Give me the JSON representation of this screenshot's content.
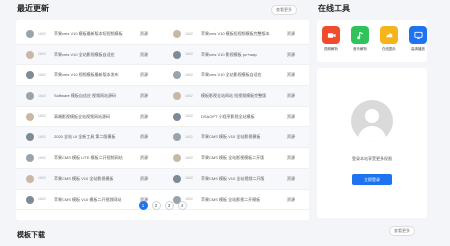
{
  "sections": {
    "latest": "最近更新",
    "tools": "在线工具",
    "templates": "模板下载"
  },
  "latest_more": "查看更多",
  "templates_more": "查看更多",
  "rows": [
    {
      "left": {
        "sub": "1602",
        "title": "苹果cms V10 模板最新版本短视频模板",
        "tag": "资源"
      },
      "right": {
        "sub": "1602",
        "title": "苹果cms V10 模板短视频模板完整版本",
        "tag": "资源"
      }
    },
    {
      "left": {
        "sub": "1602",
        "title": "苹果cms V10 全站影视模板自适应",
        "tag": "资源"
      },
      "right": {
        "sub": "1602",
        "title": "苹果cms V10 影视模板 pc+wap",
        "tag": "资源"
      }
    },
    {
      "left": {
        "sub": "1602",
        "title": "苹果cms V10 视频模板最新版本发布",
        "tag": "资源"
      },
      "right": {
        "sub": "1602",
        "title": "苹果cms V10 全站影视模板自适应",
        "tag": "资源"
      }
    },
    {
      "left": {
        "sub": "1602",
        "title": "Software 模板自适应 视频网站源码",
        "tag": "资源"
      },
      "right": {
        "sub": "1602",
        "title": "模板影视全站网站 短视频模板完整版",
        "tag": "资源"
      }
    },
    {
      "left": {
        "sub": "1602",
        "title": "高端影视模板全站视频网站源码",
        "tag": "资源"
      },
      "right": {
        "sub": "1602",
        "title": "DSAOPT 小程序影视全站模板",
        "tag": "资源"
      }
    },
    {
      "left": {
        "sub": "1602",
        "title": "2020 全站 UI 全新工具 第二版模板",
        "tag": "资源"
      },
      "right": {
        "sub": "1602",
        "title": "苹果CMS 模板 V10 全站影视模板",
        "tag": "资源"
      }
    },
    {
      "left": {
        "sub": "1602",
        "title": "苹果CMS 模板 LITE 模板二开视频网站",
        "tag": "资源"
      },
      "right": {
        "sub": "1602",
        "title": "苹果CMS 模板 全站影视模板二开版",
        "tag": "资源"
      }
    },
    {
      "left": {
        "sub": "1602",
        "title": "苹果CMS 模板 V10 全站影视模板",
        "tag": "资源"
      },
      "right": {
        "sub": "1602",
        "title": "苹果CMS 模板 V10 全站视频二开版",
        "tag": "资源"
      }
    },
    {
      "left": {
        "sub": "1602",
        "title": "苹果CMS 模板 V10 模板二开视频网站",
        "tag": "资源"
      },
      "right": {
        "sub": "1602",
        "title": "苹果CMS 模板 全站影视二开模板",
        "tag": "资源"
      }
    }
  ],
  "pagination": [
    "1",
    "2",
    "3",
    "4"
  ],
  "current_page": "1",
  "tools": [
    {
      "label": "视频解析",
      "icon": "video-icon",
      "color": "#f04b2c"
    },
    {
      "label": "音乐解析",
      "icon": "music-icon",
      "color": "#2fc35a"
    },
    {
      "label": "在线图片",
      "icon": "image-icon",
      "color": "#f5b41a"
    },
    {
      "label": "高清播放",
      "icon": "monitor-icon",
      "color": "#1e73f0"
    }
  ],
  "user": {
    "hint": "登录本站享受更多权限",
    "login_label": "立即登录"
  }
}
